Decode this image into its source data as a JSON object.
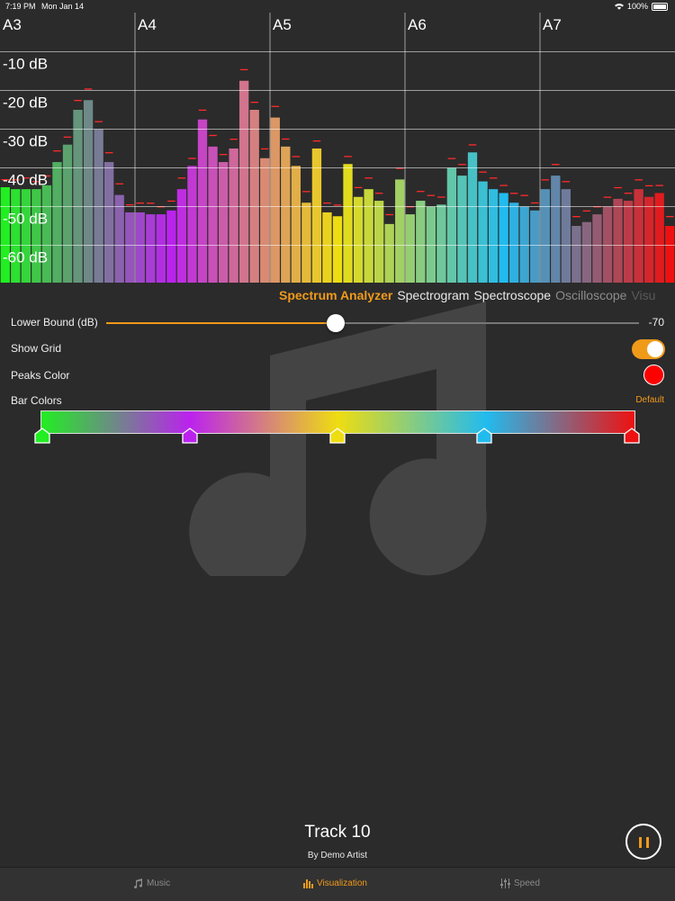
{
  "status_bar": {
    "time": "7:19 PM",
    "date": "Mon Jan 14",
    "battery": "100%"
  },
  "analyzer": {
    "note_labels": [
      "A3",
      "A4",
      "A5",
      "A6",
      "A7"
    ],
    "db_labels": [
      "-10 dB",
      "-20 dB",
      "-30 dB",
      "-40 dB",
      "-50 dB",
      "-60 dB"
    ],
    "peak_color": "#ff2a2a",
    "bar_levels_db": [
      -45,
      -45.5,
      -45.5,
      -45.5,
      -44.5,
      -38.5,
      -34,
      -25,
      -22.5,
      -30,
      -38.5,
      -47,
      -51.5,
      -51.5,
      -52,
      -52,
      -51,
      -45.5,
      -39.5,
      -27.5,
      -34.5,
      -38.5,
      -35,
      -17.5,
      -25,
      -37.5,
      -27,
      -34.5,
      -39.5,
      -49,
      -35,
      -51.5,
      -52.5,
      -39,
      -47.5,
      -45.5,
      -48.5,
      -54.5,
      -43,
      -52,
      -48.5,
      -50,
      -49.5,
      -40,
      -42,
      -36,
      -43.5,
      -45.5,
      -46.5,
      -49,
      -50,
      -51,
      -45.5,
      -42,
      -45.5,
      -55,
      -54,
      -52,
      -50,
      -48,
      -48.5,
      -45.5,
      -47.5,
      -46.5,
      -55
    ]
  },
  "modes": [
    "Spectrum Analyzer",
    "Spectrogram",
    "Spectroscope",
    "Oscilloscope",
    "Visu"
  ],
  "settings": {
    "lower_bound_label": "Lower Bound (dB)",
    "lower_bound_value": "-70",
    "lower_bound_fraction": 0.43,
    "show_grid_label": "Show Grid",
    "show_grid_on": true,
    "peaks_color_label": "Peaks Color",
    "peaks_color": "#ff0000",
    "bar_colors_label": "Bar Colors",
    "default_label": "Default",
    "gradient_stops": [
      "#22ee22",
      "#bb22ee",
      "#eedd11",
      "#22bbee",
      "#ee1111"
    ]
  },
  "player": {
    "title": "Track 10",
    "artist": "By Demo Artist"
  },
  "tabs": {
    "music": "Music",
    "visualization": "Visualization",
    "speed": "Speed"
  },
  "colors": {
    "accent": "#f09a1a",
    "background": "#2b2b2b"
  }
}
